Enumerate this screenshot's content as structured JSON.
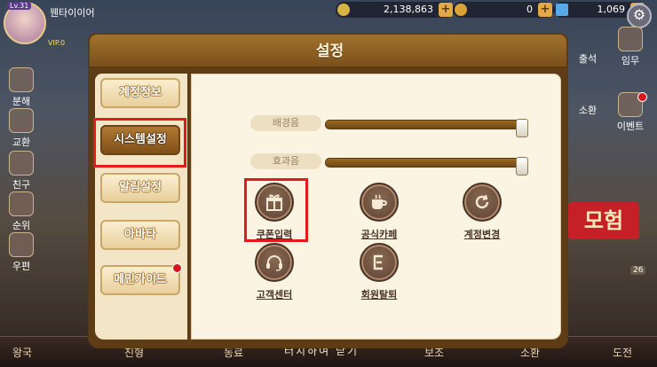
{
  "hud": {
    "level": "Lv.31",
    "nickname": "웬타이이어",
    "vip": "VIP.0",
    "gold": "2,138,863",
    "gem": "0",
    "diamond": "1,069",
    "left_menu": [
      "분해",
      "교환",
      "친구",
      "순위",
      "우편"
    ],
    "right_menu": [
      "출석",
      "임무",
      "소환",
      "이벤트"
    ],
    "right_badge": "26",
    "adventure_label": "모험",
    "bottom_menu": [
      "왕국",
      "진형",
      "동료",
      "보조",
      "소환",
      "도전"
    ],
    "touch_hint": "터치하여 닫기"
  },
  "settings": {
    "title": "설정",
    "tabs": [
      {
        "label": "계정정보",
        "active": false
      },
      {
        "label": "시스템설정",
        "active": true
      },
      {
        "label": "알림설정",
        "active": false
      },
      {
        "label": "아바타",
        "active": false
      },
      {
        "label": "메인가이드",
        "active": false,
        "badge": true
      }
    ],
    "sliders": [
      {
        "label": "배경음",
        "value": 1.0
      },
      {
        "label": "효과음",
        "value": 1.0
      }
    ],
    "options": [
      {
        "label": "쿠폰입력",
        "icon": "gift-icon"
      },
      {
        "label": "공식카페",
        "icon": "cafe-cup-icon"
      },
      {
        "label": "계정변경",
        "icon": "account-switch-icon"
      },
      {
        "label": "고객센터",
        "icon": "headset-icon"
      },
      {
        "label": "회원탈퇴",
        "icon": "withdraw-exit-icon"
      }
    ]
  },
  "colors": {
    "highlight": "#e31a1c",
    "dialog_brown": "#7a4f1a",
    "panel_cream": "#fbf4e2"
  }
}
